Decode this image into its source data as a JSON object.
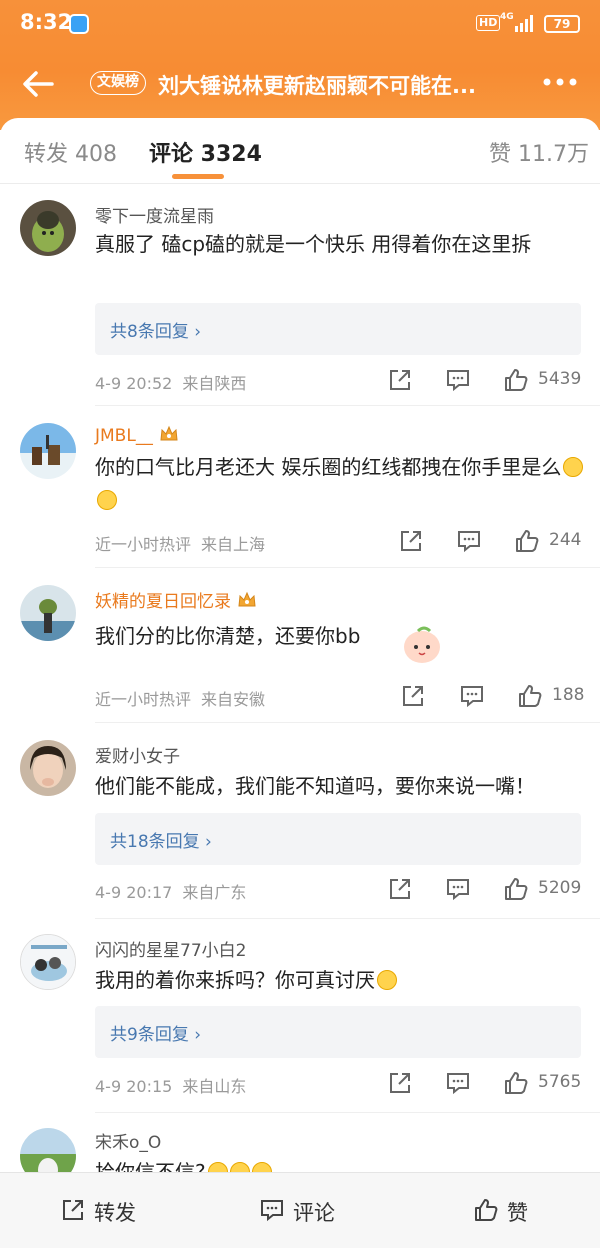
{
  "status_bar": {
    "time": "8:32",
    "hd": "HD",
    "network": "4G",
    "battery": "79"
  },
  "nav": {
    "tag": "文娱榜",
    "title": "刘大锤说林更新赵丽颖不可能在..."
  },
  "tabs": {
    "forward": "转发 408",
    "comments": "评论 3324",
    "likes": "赞 11.7万"
  },
  "comments": [
    {
      "username": "零下一度流星雨",
      "text": "真服了  磕cp磕的就是一个快乐  用得着你在这里拆",
      "replies": "共8条回复 ›",
      "time": "4-9 20:52",
      "location": "来自陕西",
      "likes": "5439"
    },
    {
      "username": "JMBL__",
      "text": "你的口气比月老还大 娱乐圈的红线都拽在你手里是么",
      "time": "近一小时热评",
      "location": "来自上海",
      "likes": "244"
    },
    {
      "username": "妖精的夏日回忆录",
      "text": "我们分的比你清楚，还要你bb",
      "time": "近一小时热评",
      "location": "来自安徽",
      "likes": "188"
    },
    {
      "username": "爱财小女子",
      "text": "他们能不能成，我们能不知道吗，要你来说一嘴！",
      "replies": "共18条回复 ›",
      "time": "4-9 20:17",
      "location": "来自广东",
      "likes": "5209"
    },
    {
      "username": "闪闪的星星77小白2",
      "text": "我用的着你来拆吗？你可真讨厌",
      "replies": "共9条回复 ›",
      "time": "4-9 20:15",
      "location": "来自山东",
      "likes": "5765"
    },
    {
      "username": "宋禾o_O",
      "text": "拾你信不信?"
    }
  ],
  "bottom_bar": {
    "forward": "转发",
    "comment": "评论",
    "like": "赞"
  },
  "colors": {
    "header_orange": "#f7913a",
    "vip_name": "#e97a1e",
    "reply_link": "#4878b0"
  },
  "icons": [
    "back-arrow-icon",
    "more-dots-icon",
    "share-icon",
    "comment-icon",
    "thumbs-up-icon",
    "crown-badge-icon"
  ]
}
